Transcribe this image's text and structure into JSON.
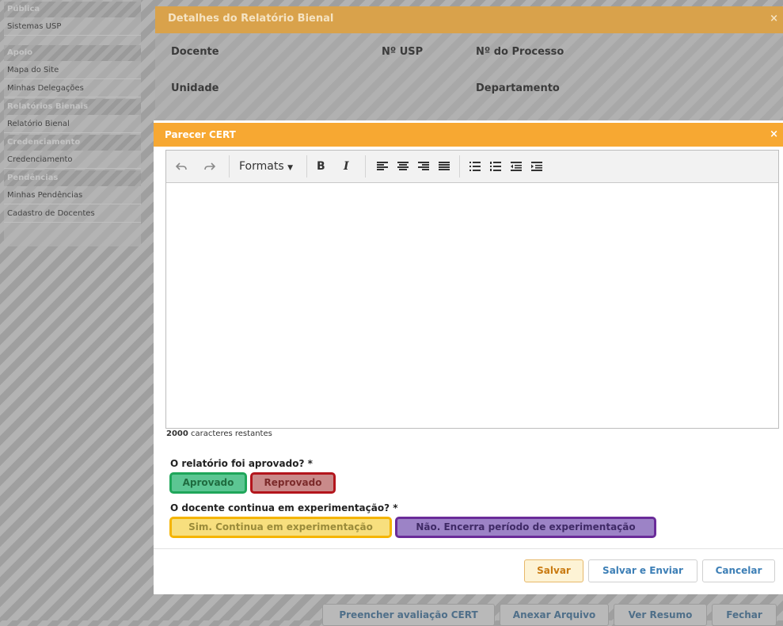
{
  "sidebar": {
    "sections": [
      {
        "header": "Pública",
        "items": [
          "Sistemas USP"
        ]
      },
      {
        "header": "Apoio",
        "items": [
          "Mapa do Site",
          "Minhas Delegações"
        ]
      },
      {
        "header": "Relatórios Bienais",
        "items": [
          "Relatório Bienal"
        ]
      },
      {
        "header": "Credenciamento",
        "items": [
          "Credenciamento"
        ]
      },
      {
        "header": "Pendências",
        "items": [
          "Minhas Pendências",
          "Cadastro de Docentes"
        ]
      }
    ]
  },
  "details_modal": {
    "title": "Detalhes do Relatório Bienal",
    "close": "×",
    "labels": {
      "docente": "Docente",
      "nusp": "Nº USP",
      "processo": "Nº do Processo",
      "unidade": "Unidade",
      "departamento": "Departamento"
    }
  },
  "modal": {
    "title": "Parecer CERT",
    "close": "×",
    "toolbar": {
      "formats_label": "Formats",
      "bold": "B",
      "italic": "I"
    },
    "chars_count": "2000",
    "chars_suffix": " caracteres restantes",
    "question1": "O relatório foi aprovado? *",
    "option_aprovado": "Aprovado",
    "option_reprovado": "Reprovado",
    "question2": "O docente continua em experimentação? *",
    "option_sim": "Sim. Continua em experimentação",
    "option_nao": "Não. Encerra período de experimentação",
    "buttons": {
      "salvar": "Salvar",
      "salvar_enviar": "Salvar e Enviar",
      "cancelar": "Cancelar"
    }
  },
  "bottom_bar": {
    "preencher": "Preencher avaliação CERT",
    "anexar": "Anexar Arquivo",
    "resumo": "Ver Resumo",
    "fechar": "Fechar"
  },
  "colors": {
    "modal_header": "#f7a832",
    "details_header": "#d9a24b",
    "aprovado": "#5cc693",
    "reprovado": "#c98a8a",
    "sim": "#f7df7e",
    "nao": "#9c83c6"
  }
}
